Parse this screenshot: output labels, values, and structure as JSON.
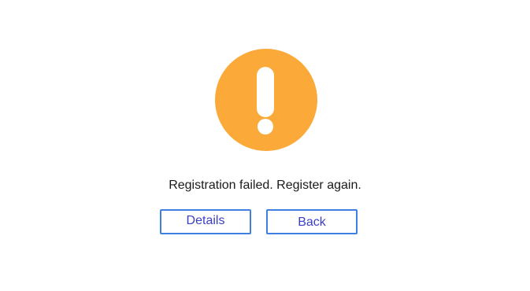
{
  "dialog": {
    "icon": "exclamation-icon",
    "icon_color": "#FBAA3A",
    "message": "Registration failed. Register again.",
    "buttons": {
      "details_label": "Details",
      "back_label": "Back"
    },
    "button_border_color": "#3F7FE0",
    "button_text_color": "#3B3FC4"
  }
}
